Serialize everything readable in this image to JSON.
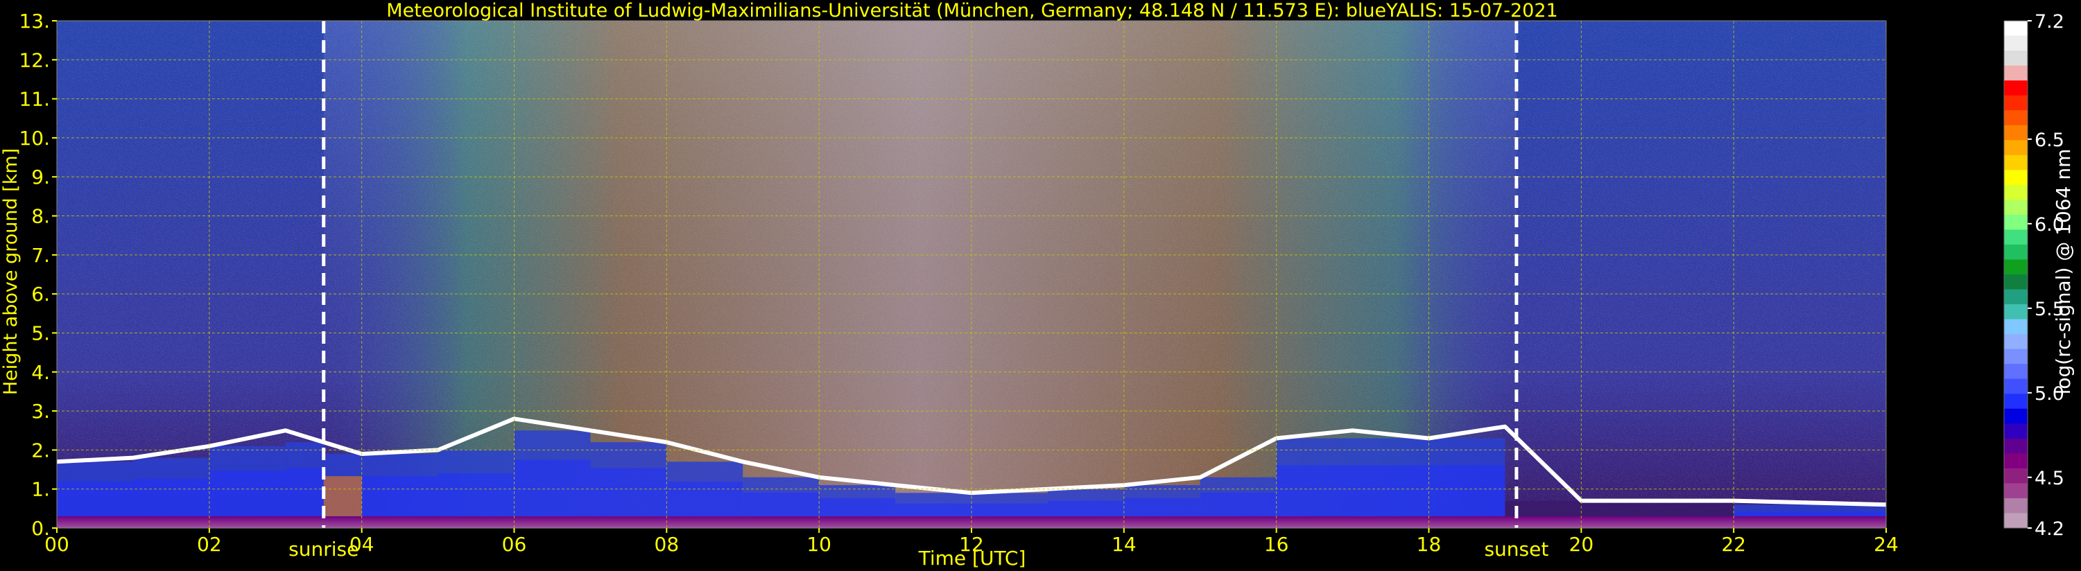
{
  "chart_data": {
    "type": "heatmap",
    "title": "Meteorological Institute of Ludwig-Maximilians-Universität (München, Germany; 48.148 N / 11.573 E):     blueYALIS: 15-07-2021",
    "xlabel": "Time [UTC]",
    "ylabel": "Height above ground [km]",
    "xlim": [
      0,
      24
    ],
    "ylim": [
      0,
      13
    ],
    "x_ticks": [
      "00",
      "02",
      "04",
      "06",
      "08",
      "10",
      "12",
      "14",
      "16",
      "18",
      "20",
      "22",
      "24"
    ],
    "y_ticks": [
      "0.",
      "1.",
      "2.",
      "3.",
      "4.",
      "5.",
      "6.",
      "7.",
      "8.",
      "9.",
      "10.",
      "11.",
      "12.",
      "13."
    ],
    "grid": true,
    "annotations": [
      {
        "label": "sunrise",
        "x": 3.5
      },
      {
        "label": "sunset",
        "x": 19.15
      }
    ],
    "colorbar": {
      "label": "log(rc-signal) @ 1064 nm",
      "range": [
        4.2,
        7.2
      ],
      "ticks": [
        "7.2",
        "6.5",
        "6.0",
        "5.5",
        "5.0",
        "4.5",
        "4.2"
      ],
      "colors_top_to_bottom": [
        "#ffffff",
        "#eeeeee",
        "#dddddd",
        "#f0b0b0",
        "#ff0000",
        "#ff2a00",
        "#ff5500",
        "#ff8000",
        "#ffaa00",
        "#ffd000",
        "#ffff00",
        "#d8ff30",
        "#b0ff60",
        "#80ff80",
        "#40e080",
        "#20c060",
        "#10a020",
        "#108040",
        "#20a080",
        "#40c0b0",
        "#80c8ff",
        "#90b0ff",
        "#7a90ff",
        "#6070ff",
        "#4050ff",
        "#2030ff",
        "#0000e0",
        "#3000c0",
        "#600090",
        "#800080",
        "#902080",
        "#a04090",
        "#b080a8",
        "#c0a0b8"
      ]
    },
    "colors": {
      "text": "#ffff00",
      "background": "#000000",
      "grid": "#c8c800"
    },
    "features": {
      "boundary_layer_top_km": [
        {
          "t": 0.0,
          "h": 1.7
        },
        {
          "t": 1.0,
          "h": 1.8
        },
        {
          "t": 2.0,
          "h": 2.1
        },
        {
          "t": 3.0,
          "h": 2.5
        },
        {
          "t": 3.5,
          "h": 2.2
        },
        {
          "t": 4.0,
          "h": 1.9
        },
        {
          "t": 5.0,
          "h": 2.0
        },
        {
          "t": 6.0,
          "h": 2.8
        },
        {
          "t": 7.0,
          "h": 2.5
        },
        {
          "t": 8.0,
          "h": 2.2
        },
        {
          "t": 9.0,
          "h": 1.7
        },
        {
          "t": 10.0,
          "h": 1.3
        },
        {
          "t": 11.0,
          "h": 1.1
        },
        {
          "t": 12.0,
          "h": 0.9
        },
        {
          "t": 13.0,
          "h": 1.0
        },
        {
          "t": 14.0,
          "h": 1.1
        },
        {
          "t": 15.0,
          "h": 1.3
        },
        {
          "t": 16.0,
          "h": 2.3
        },
        {
          "t": 17.0,
          "h": 2.5
        },
        {
          "t": 18.0,
          "h": 2.3
        },
        {
          "t": 19.0,
          "h": 2.6
        },
        {
          "t": 20.0,
          "h": 0.7
        },
        {
          "t": 22.0,
          "h": 0.7
        },
        {
          "t": 24.0,
          "h": 0.6
        }
      ]
    }
  }
}
